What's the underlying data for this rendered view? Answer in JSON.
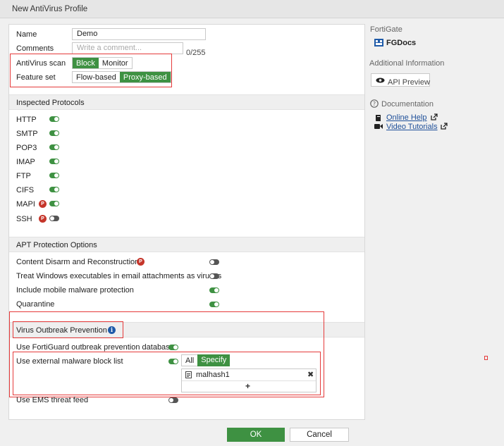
{
  "window": {
    "title": "New AntiVirus Profile"
  },
  "form": {
    "name_label": "Name",
    "name_value": "Demo",
    "comments_label": "Comments",
    "comments_placeholder": "Write a comment...",
    "comments_count": "0/255",
    "antivirus_scan": {
      "label": "AntiVirus scan",
      "options": [
        "Block",
        "Monitor"
      ],
      "selected": "Block"
    },
    "feature_set": {
      "label": "Feature set",
      "options": [
        "Flow-based",
        "Proxy-based"
      ],
      "selected": "Proxy-based"
    }
  },
  "inspected_protocols": {
    "title": "Inspected Protocols",
    "items": [
      {
        "label": "HTTP",
        "on": true,
        "proxy_badge": false
      },
      {
        "label": "SMTP",
        "on": true,
        "proxy_badge": false
      },
      {
        "label": "POP3",
        "on": true,
        "proxy_badge": false
      },
      {
        "label": "IMAP",
        "on": true,
        "proxy_badge": false
      },
      {
        "label": "FTP",
        "on": true,
        "proxy_badge": false
      },
      {
        "label": "CIFS",
        "on": true,
        "proxy_badge": false
      },
      {
        "label": "MAPI",
        "on": true,
        "proxy_badge": true
      },
      {
        "label": "SSH",
        "on": false,
        "proxy_badge": true
      }
    ],
    "badge_text": "P"
  },
  "apt_protection": {
    "title": "APT Protection Options",
    "items": [
      {
        "label": "Content Disarm and Reconstruction",
        "on": false,
        "proxy_badge": true
      },
      {
        "label": "Treat Windows executables in email attachments as viruses",
        "on": false,
        "proxy_badge": false
      },
      {
        "label": "Include mobile malware protection",
        "on": true,
        "proxy_badge": false
      },
      {
        "label": "Quarantine",
        "on": true,
        "proxy_badge": false
      }
    ]
  },
  "virus_outbreak": {
    "title": "Virus Outbreak Prevention",
    "info_icon": "info-icon",
    "fortiguard_label": "Use FortiGuard outbreak prevention database",
    "fortiguard_on": true,
    "external_label": "Use external malware block list",
    "external_on": true,
    "external_mode": {
      "options": [
        "All",
        "Specify"
      ],
      "selected": "Specify"
    },
    "block_list": [
      "malhash1"
    ],
    "add_symbol": "+",
    "remove_symbol": "✖",
    "ems_label": "Use EMS threat feed",
    "ems_on": false
  },
  "sidebar": {
    "fortigate_heading": "FortiGate",
    "fortigate_name": "FGDocs",
    "additional_heading": "Additional Information",
    "api_preview_label": "API Preview",
    "documentation_heading": "Documentation",
    "online_help": "Online Help",
    "video_tutorials": "Video Tutorials"
  },
  "footer": {
    "ok_label": "OK",
    "cancel_label": "Cancel"
  },
  "colors": {
    "accent_green": "#3e9142",
    "highlight_red": "#e53a3a",
    "link_blue": "#1e4f99",
    "proxy_badge": "#c5352a"
  }
}
